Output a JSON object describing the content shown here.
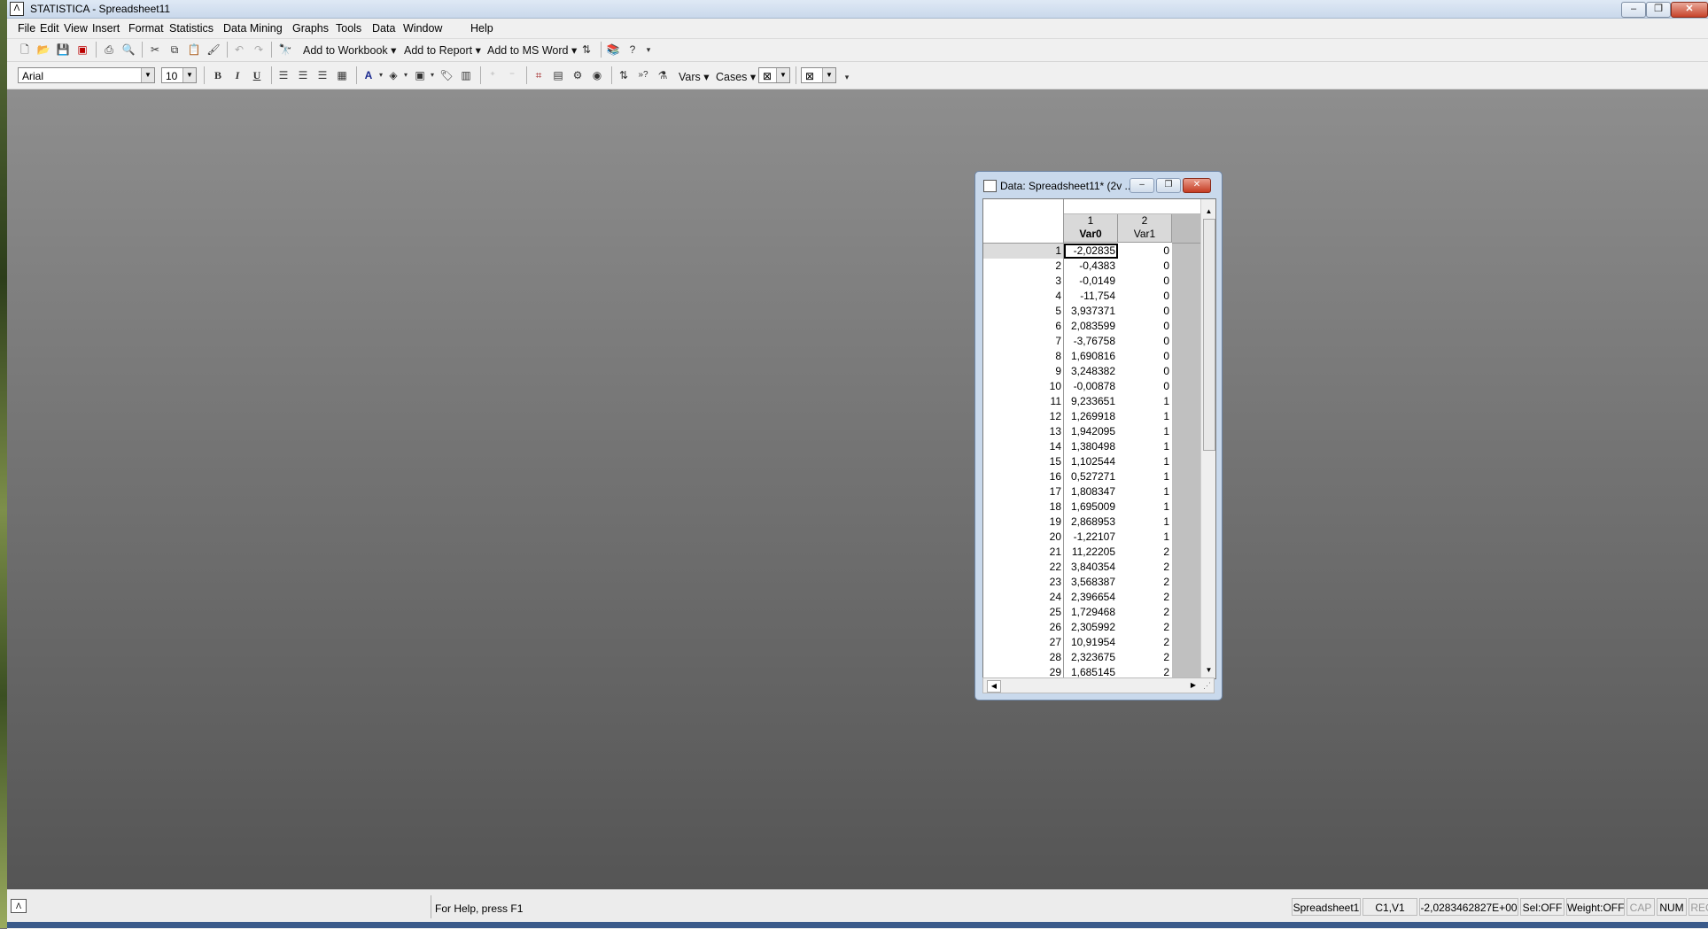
{
  "app": {
    "title": "STATISTICA - Spreadsheet11",
    "icon": "statistica-icon",
    "window_controls": {
      "minimize": "–",
      "maximize": "❐",
      "close": "✕"
    }
  },
  "menu": [
    "File",
    "Edit",
    "View",
    "Insert",
    "Format",
    "Statistics",
    "Data Mining",
    "Graphs",
    "Tools",
    "Data",
    "Window",
    "Help"
  ],
  "toolbar1": {
    "add_to_workbook": "Add to Workbook",
    "add_to_report": "Add to Report",
    "add_to_ms_word": "Add to MS Word"
  },
  "toolbar2": {
    "font": "Arial",
    "font_size": "10",
    "bold": "B",
    "italic": "I",
    "underline": "U",
    "vars": "Vars",
    "cases": "Cases"
  },
  "data_window": {
    "title": "Data: Spreadsheet11* (2v ...",
    "columns": [
      {
        "number": "1",
        "name": "Var0"
      },
      {
        "number": "2",
        "name": "Var1"
      }
    ],
    "rows": [
      {
        "n": "1",
        "v0": "-2,02835",
        "v1": "0"
      },
      {
        "n": "2",
        "v0": "-0,4383",
        "v1": "0"
      },
      {
        "n": "3",
        "v0": "-0,0149",
        "v1": "0"
      },
      {
        "n": "4",
        "v0": "-11,754",
        "v1": "0"
      },
      {
        "n": "5",
        "v0": "3,937371",
        "v1": "0"
      },
      {
        "n": "6",
        "v0": "2,083599",
        "v1": "0"
      },
      {
        "n": "7",
        "v0": "-3,76758",
        "v1": "0"
      },
      {
        "n": "8",
        "v0": "1,690816",
        "v1": "0"
      },
      {
        "n": "9",
        "v0": "3,248382",
        "v1": "0"
      },
      {
        "n": "10",
        "v0": "-0,00878",
        "v1": "0"
      },
      {
        "n": "11",
        "v0": "9,233651",
        "v1": "1"
      },
      {
        "n": "12",
        "v0": "1,269918",
        "v1": "1"
      },
      {
        "n": "13",
        "v0": "1,942095",
        "v1": "1"
      },
      {
        "n": "14",
        "v0": "1,380498",
        "v1": "1"
      },
      {
        "n": "15",
        "v0": "1,102544",
        "v1": "1"
      },
      {
        "n": "16",
        "v0": "0,527271",
        "v1": "1"
      },
      {
        "n": "17",
        "v0": "1,808347",
        "v1": "1"
      },
      {
        "n": "18",
        "v0": "1,695009",
        "v1": "1"
      },
      {
        "n": "19",
        "v0": "2,868953",
        "v1": "1"
      },
      {
        "n": "20",
        "v0": "-1,22107",
        "v1": "1"
      },
      {
        "n": "21",
        "v0": "11,22205",
        "v1": "2"
      },
      {
        "n": "22",
        "v0": "3,840354",
        "v1": "2"
      },
      {
        "n": "23",
        "v0": "3,568387",
        "v1": "2"
      },
      {
        "n": "24",
        "v0": "2,396654",
        "v1": "2"
      },
      {
        "n": "25",
        "v0": "1,729468",
        "v1": "2"
      },
      {
        "n": "26",
        "v0": "2,305992",
        "v1": "2"
      },
      {
        "n": "27",
        "v0": "10,91954",
        "v1": "2"
      },
      {
        "n": "28",
        "v0": "2,323675",
        "v1": "2"
      },
      {
        "n": "29",
        "v0": "1,685145",
        "v1": "2"
      }
    ]
  },
  "status": {
    "help": "For Help, press F1",
    "sheet": "Spreadsheet1",
    "cell": "C1,V1",
    "value": "-2,0283462827E+00",
    "sel": "Sel:OFF",
    "weight": "Weight:OFF",
    "cap": "CAP",
    "num": "NUM",
    "rec": "REC"
  }
}
